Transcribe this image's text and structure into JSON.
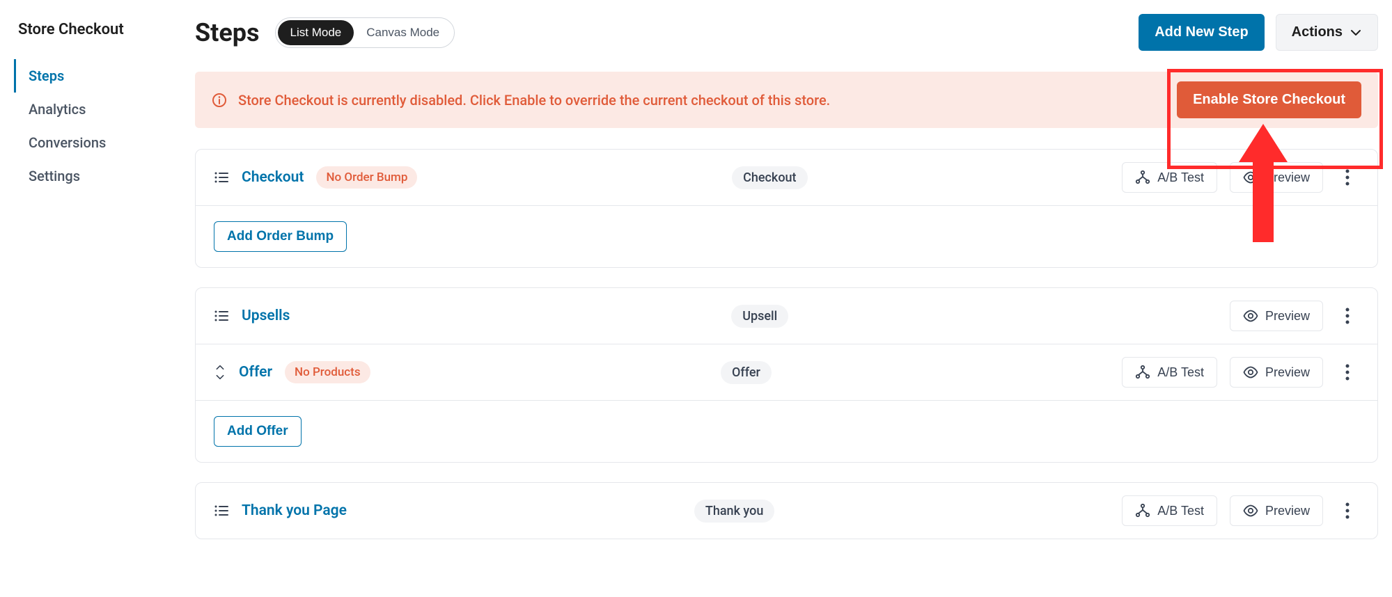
{
  "sidebar": {
    "title": "Store Checkout",
    "items": [
      {
        "label": "Steps",
        "active": true
      },
      {
        "label": "Analytics",
        "active": false
      },
      {
        "label": "Conversions",
        "active": false
      },
      {
        "label": "Settings",
        "active": false
      }
    ]
  },
  "header": {
    "title": "Steps",
    "modes": {
      "list": "List Mode",
      "canvas": "Canvas Mode"
    },
    "add_new_step": "Add New Step",
    "actions": "Actions"
  },
  "alert": {
    "text": "Store Checkout is currently disabled. Click Enable to override the current checkout of this store.",
    "button": "Enable Store Checkout"
  },
  "buttons": {
    "ab_test": "A/B Test",
    "preview": "Preview",
    "add_order_bump": "Add Order Bump",
    "add_offer": "Add Offer"
  },
  "steps": {
    "checkout": {
      "name": "Checkout",
      "type_pill": "Checkout",
      "tag": "No Order Bump"
    },
    "upsells": {
      "name": "Upsells",
      "type_pill": "Upsell"
    },
    "offer": {
      "name": "Offer",
      "type_pill": "Offer",
      "tag": "No Products"
    },
    "thankyou": {
      "name": "Thank you Page",
      "type_pill": "Thank you"
    }
  }
}
